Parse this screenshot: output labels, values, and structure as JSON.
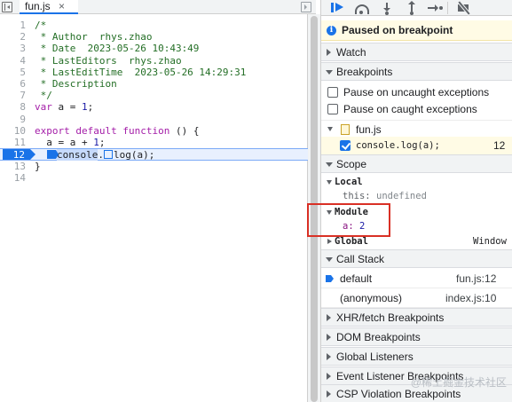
{
  "editor": {
    "file_tab": "fun.js",
    "tab_close": "×",
    "lines": [
      {
        "n": "1",
        "text": "/*"
      },
      {
        "n": "2",
        "text": " * Author  rhys.zhao"
      },
      {
        "n": "3",
        "text": " * Date  2023-05-26 10:43:49"
      },
      {
        "n": "4",
        "text": " * LastEditors  rhys.zhao"
      },
      {
        "n": "5",
        "text": " * LastEditTime  2023-05-26 14:29:31"
      },
      {
        "n": "6",
        "text": " * Description"
      },
      {
        "n": "7",
        "text": " */"
      },
      {
        "n": "8",
        "kw": "var",
        "rest": " a = ",
        "num": "1",
        "tail": ";"
      },
      {
        "n": "9",
        "text": ""
      },
      {
        "n": "10",
        "kw": "export default function",
        "tail": " () {"
      },
      {
        "n": "11",
        "text": "  a = a + ",
        "num": "1",
        "tail": ";"
      },
      {
        "n": "12",
        "obj": "console",
        "dot": ".",
        "method": "log(a);"
      },
      {
        "n": "13",
        "text": "}"
      },
      {
        "n": "14",
        "text": ""
      }
    ]
  },
  "sidebar": {
    "paused_message": "Paused on breakpoint",
    "watch": "Watch",
    "breakpoints": {
      "title": "Breakpoints",
      "pause_uncaught": "Pause on uncaught exceptions",
      "pause_caught": "Pause on caught exceptions",
      "file": "fun.js",
      "bp_code": "console.log(a);",
      "bp_line": "12"
    },
    "scope": {
      "title": "Scope",
      "local_label": "Local",
      "this_key": "this:",
      "this_value": "undefined",
      "module_label": "Module",
      "a_key": "a:",
      "a_value": "2",
      "global_label": "Global",
      "global_value": "Window"
    },
    "call_stack": {
      "title": "Call Stack",
      "frames": [
        {
          "name": "default",
          "location": "fun.js:12"
        },
        {
          "name": "(anonymous)",
          "location": "index.js:10"
        }
      ]
    },
    "sections": [
      "XHR/fetch Breakpoints",
      "DOM Breakpoints",
      "Global Listeners",
      "Event Listener Breakpoints",
      "CSP Violation Breakpoints"
    ]
  },
  "watermark": "@稀土掘金技术社区",
  "colors": {
    "accent": "#1a73e8",
    "highlight_box": "#d93025",
    "paused_banner": "#fffbe5"
  }
}
